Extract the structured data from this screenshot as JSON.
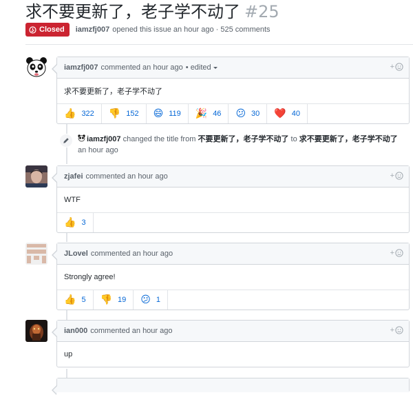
{
  "issue": {
    "title": "求不要更新了，老子学不动了",
    "number": "#25",
    "state": "Closed",
    "author": "iamzfj007",
    "meta_text": "opened this issue an hour ago · 525 comments"
  },
  "comments": [
    {
      "author": "iamzfj007",
      "action": "commented an hour ago",
      "edited": "• edited",
      "body": "求不要更新了，老子学不动了",
      "reactions": [
        {
          "emoji": "👍",
          "count": "322"
        },
        {
          "emoji": "👎",
          "count": "152"
        },
        {
          "emoji": "😄",
          "count": "119"
        },
        {
          "emoji": "🎉",
          "count": "46"
        },
        {
          "emoji": "😕",
          "count": "30"
        },
        {
          "emoji": "❤️",
          "count": "40"
        }
      ]
    },
    {
      "author": "zjafei",
      "action": "commented an hour ago",
      "body": "WTF",
      "reactions": [
        {
          "emoji": "👍",
          "count": "3"
        }
      ]
    },
    {
      "author": "JLovel",
      "action": "commented an hour ago",
      "body": "Strongly agree!",
      "reactions": [
        {
          "emoji": "👍",
          "count": "5"
        },
        {
          "emoji": "👎",
          "count": "19"
        },
        {
          "emoji": "😕",
          "count": "1"
        }
      ]
    },
    {
      "author": "ian000",
      "action": "commented an hour ago",
      "body": "up"
    }
  ],
  "event": {
    "actor": "iamzfj007",
    "action": "changed the title from",
    "from_title": "不要更新了，老子学不动了",
    "to_word": "to",
    "to_title": "求不要更新了，老子学不动了",
    "time": "an hour ago"
  },
  "ui": {
    "add_reaction": "+"
  },
  "colors": {
    "closed_badge": "#cb2431",
    "link_blue": "#0366d6",
    "header_bg": "#f6f8fa"
  },
  "icons": [
    "issue-closed-icon",
    "pencil-icon",
    "smiley-icon"
  ]
}
